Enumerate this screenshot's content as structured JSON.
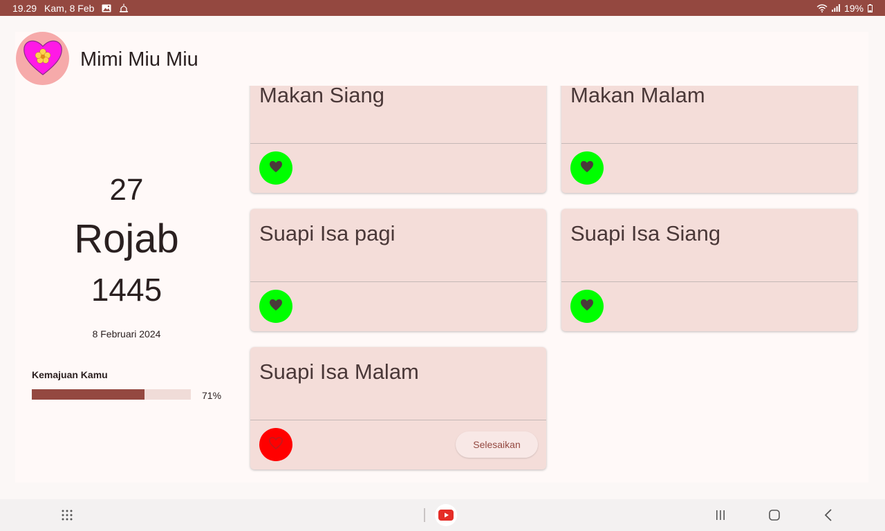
{
  "status_bar": {
    "time": "19.29",
    "date": "Kam, 8 Feb",
    "battery": "19%",
    "icons": [
      "image-icon",
      "mosque-icon",
      "wifi-icon",
      "signal-icon",
      "battery-icon"
    ]
  },
  "app": {
    "title": "Mimi Miu Miu",
    "avatar_icon": "heart-flower-icon"
  },
  "calendar": {
    "day": "27",
    "month": "Rojab",
    "year": "1445",
    "gregorian_date": "8 Februari 2024"
  },
  "progress": {
    "label": "Kemajuan Kamu",
    "value": 0.71,
    "text": "71%"
  },
  "tasks": [
    {
      "title": "Makan Siang",
      "done": true,
      "icon": "heart-icon"
    },
    {
      "title": "Makan Malam",
      "done": true,
      "icon": "heart-icon"
    },
    {
      "title": "Suapi Isa pagi",
      "done": true,
      "icon": "heart-icon"
    },
    {
      "title": "Suapi Isa Siang",
      "done": true,
      "icon": "heart-icon"
    },
    {
      "title": "Suapi Isa Malam",
      "done": false,
      "icon": "heart-outline-icon",
      "action_label": "Selesaikan"
    }
  ],
  "colors": {
    "accent": "#944840",
    "done": "#00ff00",
    "pending": "#ff0000",
    "card": "#f4ddd9"
  },
  "nav_bar": {
    "icons": [
      "apps-grid-icon",
      "youtube-icon",
      "recents-icon",
      "home-icon",
      "back-icon"
    ]
  }
}
